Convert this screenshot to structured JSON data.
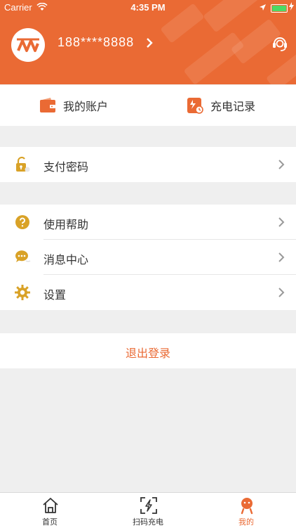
{
  "status_bar": {
    "carrier": "Carrier",
    "time": "4:35 PM"
  },
  "profile": {
    "phone": "188****8888"
  },
  "quick_actions": [
    {
      "label": "我的账户",
      "icon": "wallet-icon"
    },
    {
      "label": "充电记录",
      "icon": "charge-record-icon"
    }
  ],
  "menu_security": [
    {
      "label": "支付密码",
      "icon": "lock-icon"
    }
  ],
  "menu_main": [
    {
      "label": "使用帮助",
      "icon": "help-icon"
    },
    {
      "label": "消息中心",
      "icon": "message-icon"
    },
    {
      "label": "设置",
      "icon": "gear-icon"
    }
  ],
  "logout_label": "退出登录",
  "tabs": [
    {
      "label": "首页",
      "icon": "home-icon",
      "active": false
    },
    {
      "label": "扫码充电",
      "icon": "scan-charge-icon",
      "active": false
    },
    {
      "label": "我的",
      "icon": "profile-icon",
      "active": true
    }
  ],
  "colors": {
    "brand": "#ea6a34",
    "icon_gold": "#d9a227"
  }
}
